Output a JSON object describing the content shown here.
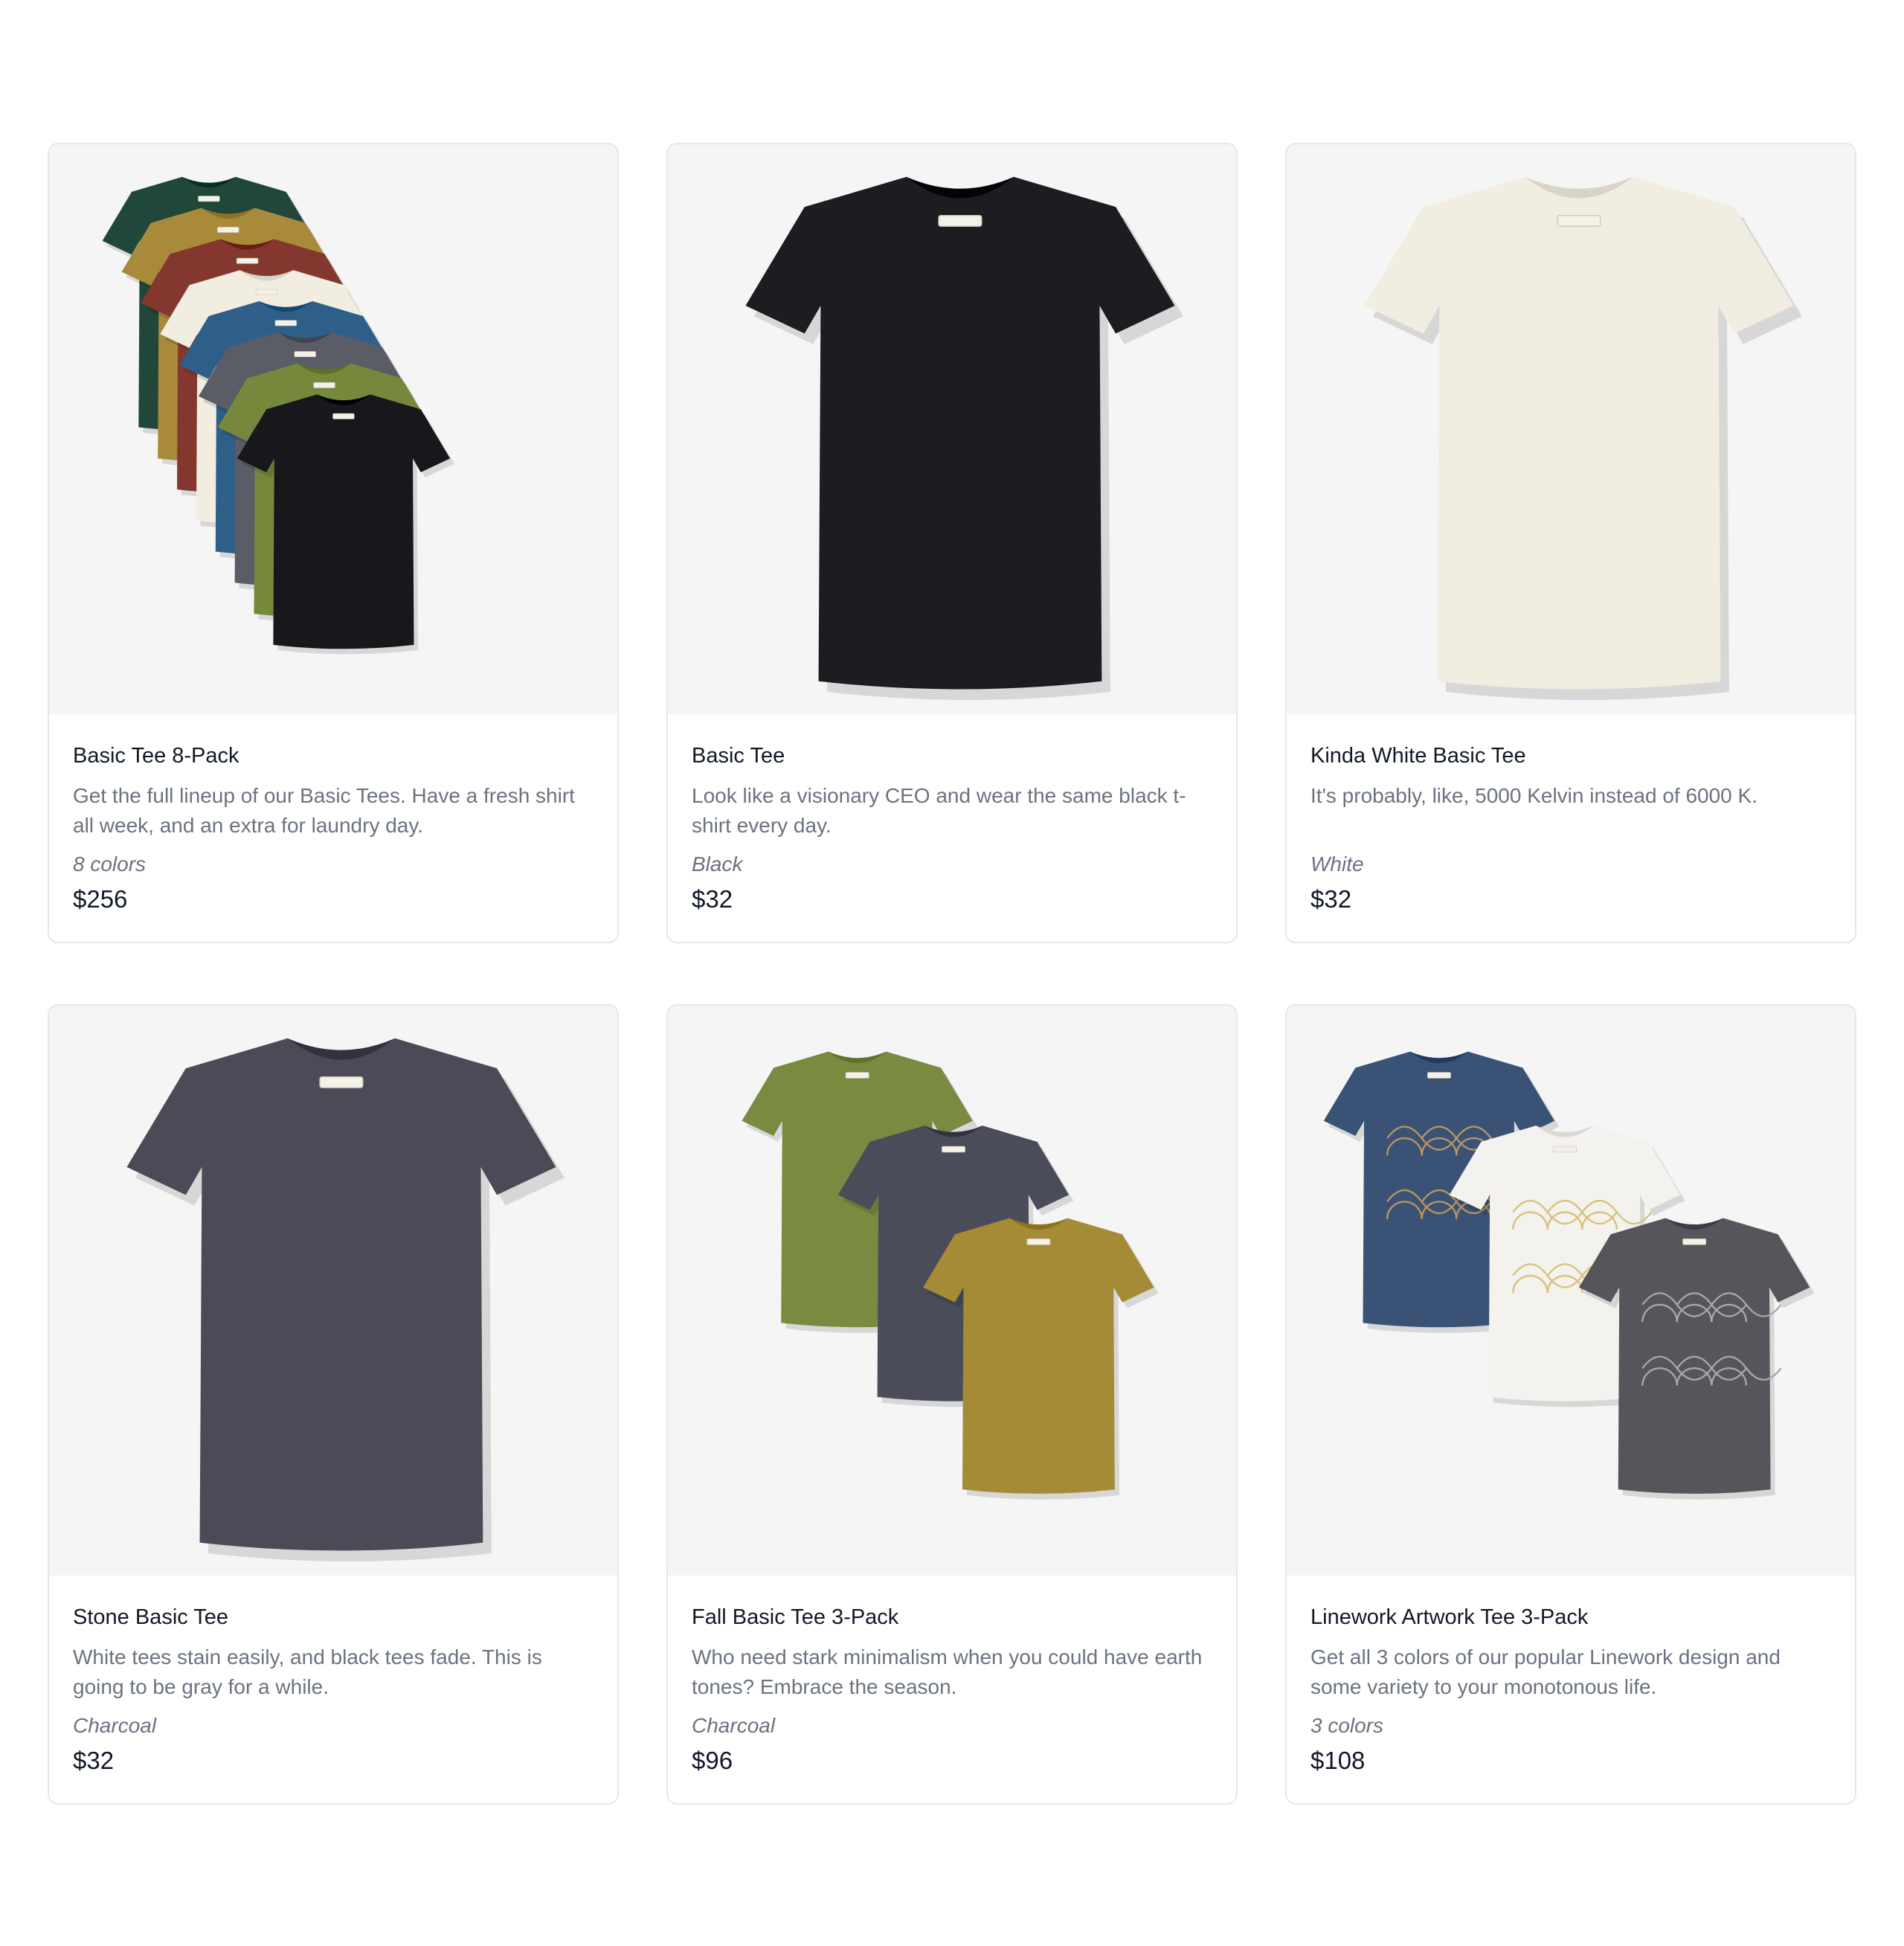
{
  "products": [
    {
      "name": "Basic Tee 8-Pack",
      "description": "Get the full lineup of our Basic Tees. Have a fresh shirt all week, and an extra for laundry day.",
      "options": "8 colors",
      "price": "$256",
      "image_icon": "tshirt-stack-8-icon",
      "shirt_colors": [
        "#21473b",
        "#a88a3a",
        "#84372e",
        "#f1ede1",
        "#2e5f88",
        "#5a5c66",
        "#76883c",
        "#17171c"
      ]
    },
    {
      "name": "Basic Tee",
      "description": "Look like a visionary CEO and wear the same black t-shirt every day.",
      "options": "Black",
      "price": "$32",
      "image_icon": "tshirt-icon",
      "shirt_colors": [
        "#1c1c21"
      ]
    },
    {
      "name": "Kinda White Basic Tee",
      "description": "It's probably, like, 5000 Kelvin instead of 6000 K.",
      "options": "White",
      "price": "$32",
      "image_icon": "tshirt-icon",
      "shirt_colors": [
        "#f1ede0"
      ]
    },
    {
      "name": "Stone Basic Tee",
      "description": "White tees stain easily, and black tees fade. This is going to be gray for a while.",
      "options": "Charcoal",
      "price": "$32",
      "image_icon": "tshirt-icon",
      "shirt_colors": [
        "#4a4b56"
      ]
    },
    {
      "name": "Fall Basic Tee 3-Pack",
      "description": "Who need stark minimalism when you could have earth tones? Embrace the season.",
      "options": "Charcoal",
      "price": "$96",
      "image_icon": "tshirt-trio-icon",
      "shirt_colors": [
        "#7a8a40",
        "#4b4c5a",
        "#a68b36"
      ]
    },
    {
      "name": "Linework Artwork Tee 3-Pack",
      "description": "Get all 3 colors of our popular Linework design and some variety to your monotonous life.",
      "options": "3 colors",
      "price": "$108",
      "image_icon": "tshirt-trio-artwork-icon",
      "shirt_colors": [
        "#3a5275",
        "#f3f2ee",
        "#55555b"
      ]
    }
  ]
}
